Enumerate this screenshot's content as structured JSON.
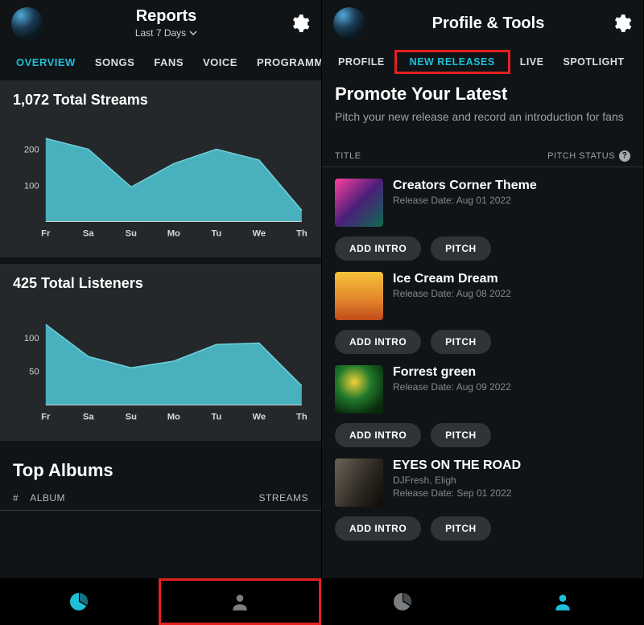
{
  "left": {
    "header": {
      "title": "Reports",
      "subtitle": "Last 7 Days"
    },
    "tabs": [
      "OVERVIEW",
      "SONGS",
      "FANS",
      "VOICE",
      "PROGRAMM"
    ],
    "panels": {
      "streams": "1,072 Total Streams",
      "listeners": "425 Total Listeners"
    },
    "top_albums": {
      "title": "Top Albums",
      "cols": {
        "num": "#",
        "album": "ALBUM",
        "streams": "STREAMS"
      }
    }
  },
  "right": {
    "header": {
      "title": "Profile & Tools"
    },
    "tabs": [
      "PROFILE",
      "NEW RELEASES",
      "LIVE",
      "SPOTLIGHT"
    ],
    "promo": {
      "title": "Promote Your Latest",
      "desc": "Pitch your new release and record an introduction for fans"
    },
    "table": {
      "title": "TITLE",
      "status": "PITCH STATUS"
    },
    "buttons": {
      "intro": "ADD INTRO",
      "pitch": "PITCH"
    },
    "releases": [
      {
        "title": "Creators Corner Theme",
        "sub": "Release Date: Aug 01 2022"
      },
      {
        "title": "Ice Cream Dream",
        "sub": "Release Date: Aug 08 2022"
      },
      {
        "title": "Forrest green",
        "sub": "Release Date: Aug 09 2022"
      },
      {
        "title": "EYES ON THE ROAD",
        "sub": "DJFresh, Eligh",
        "sub2": "Release Date: Sep 01 2022"
      }
    ]
  },
  "chart_data": [
    {
      "type": "area",
      "title": "1,072 Total Streams",
      "categories": [
        "Fr",
        "Sa",
        "Su",
        "Mo",
        "Tu",
        "We",
        "Th"
      ],
      "values": [
        230,
        200,
        95,
        160,
        200,
        170,
        30
      ],
      "ylabel": "",
      "xlabel": "",
      "yticks": [
        100,
        200
      ],
      "ylim": [
        0,
        260
      ]
    },
    {
      "type": "area",
      "title": "425 Total Listeners",
      "categories": [
        "Fr",
        "Sa",
        "Su",
        "Mo",
        "Tu",
        "We",
        "Th"
      ],
      "values": [
        120,
        72,
        55,
        65,
        90,
        92,
        28
      ],
      "ylabel": "",
      "xlabel": "",
      "yticks": [
        50,
        100
      ],
      "ylim": [
        0,
        140
      ]
    }
  ]
}
